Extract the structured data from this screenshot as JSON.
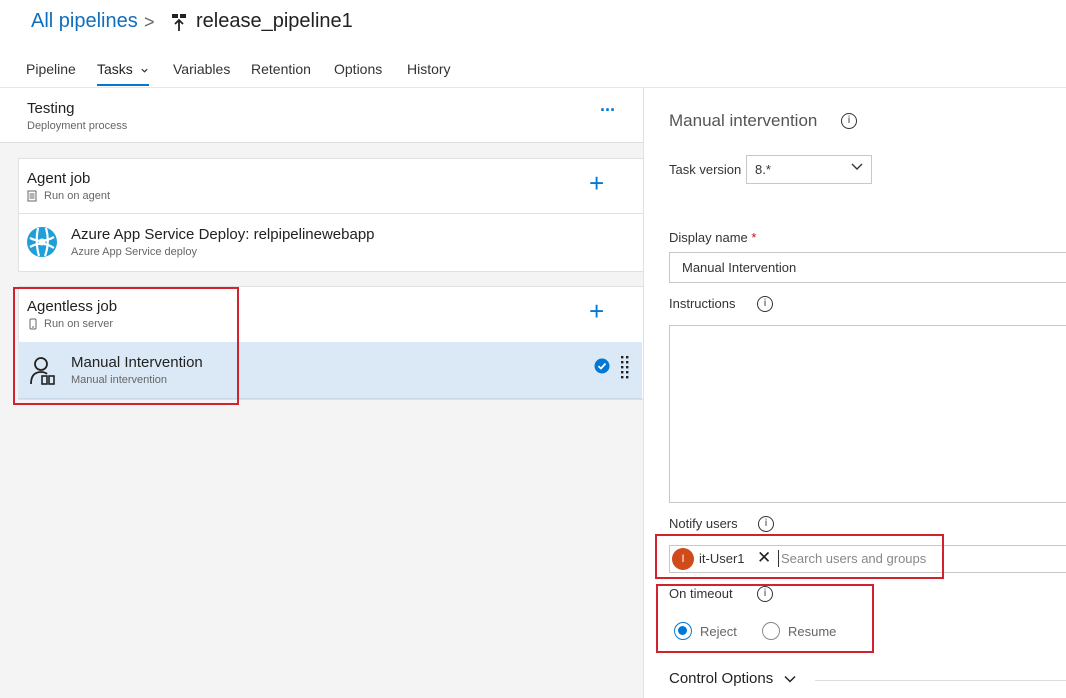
{
  "header": {
    "breadcrumb": "All pipelines",
    "separator": ">",
    "pipeline_name": "release_pipeline1",
    "tabs": [
      "Pipeline",
      "Tasks",
      "Variables",
      "Retention",
      "Options",
      "History"
    ],
    "active_tab_index": 1
  },
  "stage": {
    "name": "Testing",
    "subtitle": "Deployment process",
    "more_label": "···"
  },
  "jobs": [
    {
      "title": "Agent job",
      "subtitle": "Run on agent",
      "add_label": "+",
      "tasks": [
        {
          "title": "Azure App Service Deploy: relpipelinewebapp",
          "subtitle": "Azure App Service deploy",
          "icon": "azure-app-service-icon"
        }
      ]
    },
    {
      "title": "Agentless job",
      "subtitle": "Run on server",
      "add_label": "+",
      "tasks": [
        {
          "title": "Manual Intervention",
          "subtitle": "Manual intervention",
          "icon": "manual-intervention-icon",
          "selected": true
        }
      ]
    }
  ],
  "details": {
    "title": "Manual intervention",
    "task_version_label": "Task version",
    "task_version_value": "8.*",
    "display_name_label": "Display name",
    "required_mark": "*",
    "display_name_value": "Manual Intervention",
    "instructions_label": "Instructions",
    "instructions_value": "",
    "notify_label": "Notify users",
    "notify_user_initial": "I",
    "notify_user_name": "it-User1",
    "notify_user_remove": "✕",
    "search_placeholder": "Search users and groups",
    "timeout_label": "On timeout",
    "timeout_options": [
      "Reject",
      "Resume"
    ],
    "timeout_selected": "Reject",
    "control_options_label": "Control Options",
    "info_glyph": "i"
  },
  "colors": {
    "accent": "#0078d4",
    "highlight_box": "#d1222e",
    "selected_row": "#dbe9f6",
    "avatar": "#d04a1a"
  }
}
